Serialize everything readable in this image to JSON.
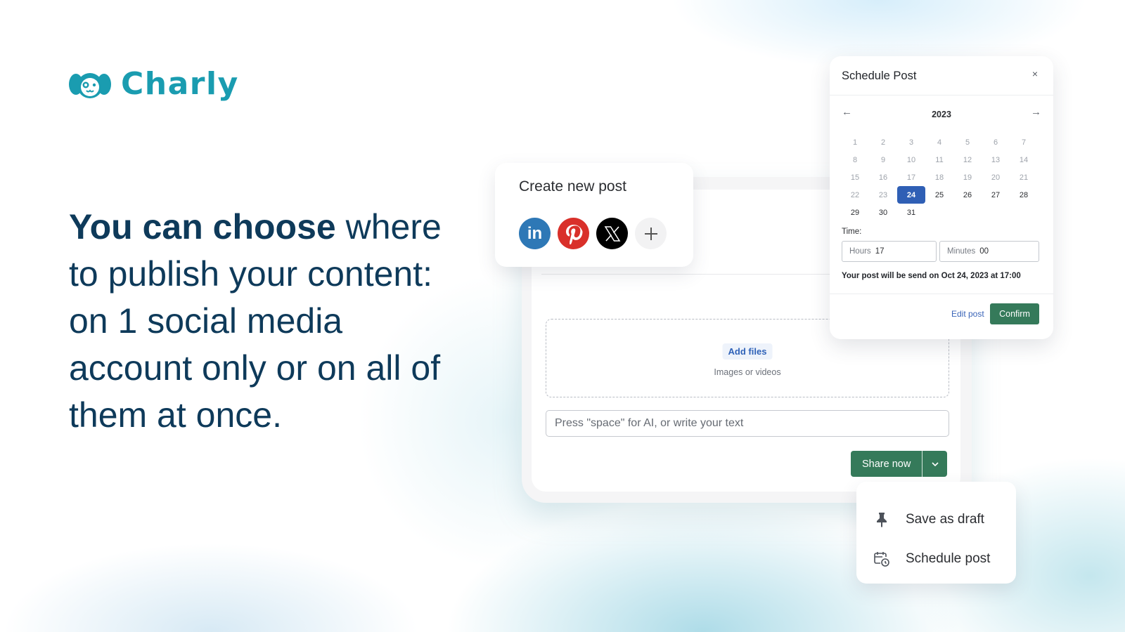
{
  "brand": {
    "name": "Charly",
    "color": "#1a9cb0"
  },
  "headline": {
    "bold": "You can choose",
    "rest": " where to publish your content: on 1 social media account only or on all of them at once."
  },
  "create_post": {
    "title": "Create new post",
    "networks": [
      {
        "name": "LinkedIn",
        "icon": "linkedin-icon",
        "glyph": "in",
        "color": "#2e78b6"
      },
      {
        "name": "Pinterest",
        "icon": "pinterest-icon",
        "color": "#d9302a"
      },
      {
        "name": "X",
        "icon": "x-icon",
        "color": "#000000"
      },
      {
        "name": "Add",
        "icon": "plus-icon"
      }
    ]
  },
  "composer": {
    "add_files_label": "Add files",
    "dropzone_hint": "Images or videos",
    "text_placeholder": "Press \"space\" for AI, or write your text",
    "share_label": "Share now"
  },
  "schedule_modal": {
    "title": "Schedule Post",
    "close_glyph": "×",
    "prev_glyph": "←",
    "next_glyph": "→",
    "year": "2023",
    "days": [
      "1",
      "2",
      "3",
      "4",
      "5",
      "6",
      "7",
      "8",
      "9",
      "10",
      "11",
      "12",
      "13",
      "14",
      "15",
      "16",
      "17",
      "18",
      "19",
      "20",
      "21",
      "22",
      "23",
      "24",
      "25",
      "26",
      "27",
      "28",
      "29",
      "30",
      "31"
    ],
    "selected_day": "24",
    "time_label": "Time:",
    "hours_label": "Hours",
    "hours_value": "17",
    "minutes_label": "Minutes",
    "minutes_value": "00",
    "send_info": "Your post will be send on Oct 24, 2023 at 17:00",
    "edit_label": "Edit post",
    "confirm_label": "Confirm"
  },
  "share_menu": {
    "items": [
      {
        "label": "Save as draft",
        "icon": "pin-icon"
      },
      {
        "label": "Schedule post",
        "icon": "calendar-clock-icon"
      }
    ]
  },
  "colors": {
    "primary_green": "#357a5a",
    "selected_blue": "#2f5fb5",
    "heading": "#0e3a5a"
  }
}
